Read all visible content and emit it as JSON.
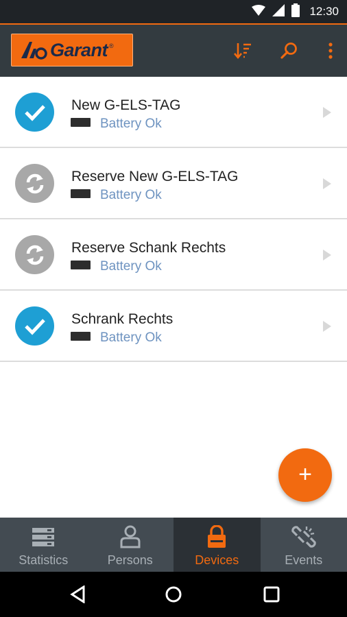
{
  "status_bar": {
    "time": "12:30"
  },
  "app_bar": {
    "logo_text": "Garant",
    "logo_mark": "®",
    "actions": [
      "sort-icon",
      "search-icon",
      "more-vert-icon"
    ]
  },
  "devices": [
    {
      "name": "New G-ELS-TAG",
      "status": "ok",
      "battery": "Battery Ok"
    },
    {
      "name": "Reserve New G-ELS-TAG",
      "status": "syncing",
      "battery": "Battery Ok"
    },
    {
      "name": "Reserve Schank Rechts",
      "status": "syncing",
      "battery": "Battery Ok"
    },
    {
      "name": "Schrank Rechts",
      "status": "ok",
      "battery": "Battery Ok"
    }
  ],
  "fab": {
    "glyph": "+"
  },
  "bottom_nav": [
    {
      "label": "Statistics",
      "icon": "statistics-icon",
      "active": false
    },
    {
      "label": "Persons",
      "icon": "person-icon",
      "active": false
    },
    {
      "label": "Devices",
      "icon": "lock-icon",
      "active": true
    },
    {
      "label": "Events",
      "icon": "broken-link-icon",
      "active": false
    }
  ],
  "colors": {
    "accent": "#f26a10",
    "app_bar": "#333b40",
    "ok": "#1e9fd4",
    "sync": "#a8a8a8",
    "battery_text": "#6e93c0",
    "nav_bg": "#434b52",
    "nav_active_bg": "#2b3035"
  }
}
